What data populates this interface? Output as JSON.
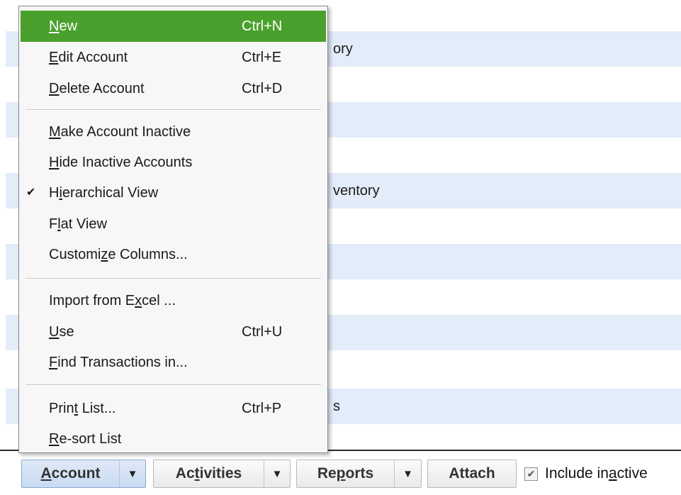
{
  "list_rows": [
    {
      "text": ""
    },
    {
      "text": "ory"
    },
    {
      "text": ""
    },
    {
      "text": ""
    },
    {
      "text": ""
    },
    {
      "text": "ventory"
    },
    {
      "text": ""
    },
    {
      "text": ""
    },
    {
      "text": ""
    },
    {
      "text": ""
    },
    {
      "text": ""
    },
    {
      "text": "s"
    }
  ],
  "menu": {
    "new": {
      "pre": "",
      "key": "N",
      "post": "ew",
      "shortcut": "Ctrl+N"
    },
    "edit": {
      "pre": "",
      "key": "E",
      "post": "dit Account",
      "shortcut": "Ctrl+E"
    },
    "delete": {
      "pre": "",
      "key": "D",
      "post": "elete Account",
      "shortcut": "Ctrl+D"
    },
    "inactive": {
      "pre": "",
      "key": "M",
      "post": "ake Account Inactive"
    },
    "hide": {
      "pre": "",
      "key": "H",
      "post": "ide Inactive Accounts"
    },
    "hierarchical": {
      "pre": "H",
      "key": "i",
      "post": "erarchical View",
      "check": "✔"
    },
    "flat": {
      "pre": "F",
      "key": "l",
      "post": "at View"
    },
    "customize": {
      "pre": "Customi",
      "key": "z",
      "post": "e Columns..."
    },
    "import": {
      "pre": "Import from E",
      "key": "x",
      "post": "cel ..."
    },
    "use": {
      "pre": "",
      "key": "U",
      "post": "se",
      "shortcut": "Ctrl+U"
    },
    "find": {
      "pre": "",
      "key": "F",
      "post": "ind Transactions in..."
    },
    "print": {
      "pre": "Prin",
      "key": "t",
      "post": " List...",
      "shortcut": "Ctrl+P"
    },
    "resort": {
      "pre": "",
      "key": "R",
      "post": "e-sort List"
    }
  },
  "toolbar": {
    "account": {
      "pre": "",
      "key": "A",
      "post": "ccount"
    },
    "activities": {
      "pre": "Ac",
      "key": "t",
      "post": "ivities"
    },
    "reports": {
      "pre": "Re",
      "key": "p",
      "post": "orts"
    },
    "attach": "Attach",
    "arrow": "▼",
    "include_inactive": {
      "pre": "Include in",
      "key": "a",
      "post": "ctive",
      "checked": true,
      "check_glyph": "✔"
    }
  },
  "colors": {
    "highlight": "#4aa02c",
    "row_alt": "#e3ecf9"
  }
}
